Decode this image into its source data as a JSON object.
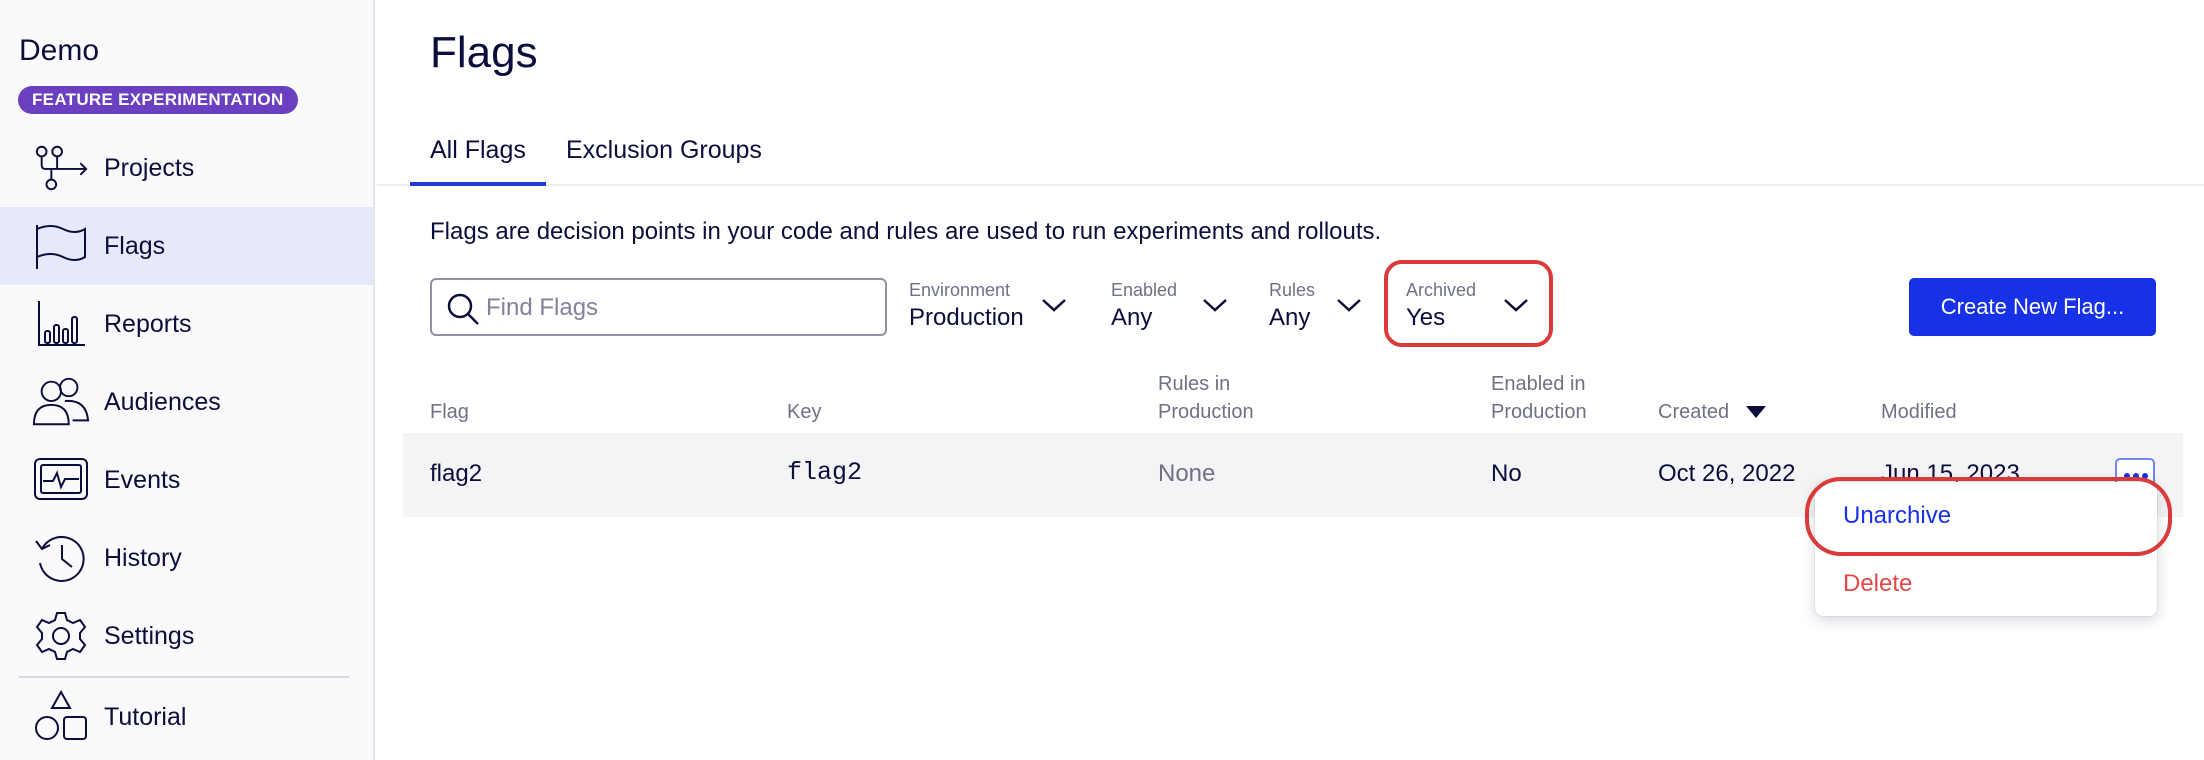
{
  "app": {
    "title": "Demo",
    "badge": "FEATURE EXPERIMENTATION"
  },
  "sidebar": {
    "items": [
      {
        "label": "Projects",
        "icon": "projects-icon"
      },
      {
        "label": "Flags",
        "icon": "flag-icon",
        "active": true
      },
      {
        "label": "Reports",
        "icon": "reports-icon"
      },
      {
        "label": "Audiences",
        "icon": "audiences-icon"
      },
      {
        "label": "Events",
        "icon": "events-icon"
      },
      {
        "label": "History",
        "icon": "history-icon"
      },
      {
        "label": "Settings",
        "icon": "gear-icon"
      },
      {
        "label": "Tutorial",
        "icon": "shapes-icon"
      }
    ]
  },
  "page": {
    "title": "Flags",
    "tabs": [
      {
        "label": "All Flags",
        "active": true
      },
      {
        "label": "Exclusion Groups"
      }
    ],
    "description": "Flags are decision points in your code and rules are used to run experiments and rollouts."
  },
  "search": {
    "placeholder": "Find Flags",
    "value": ""
  },
  "filters": [
    {
      "label": "Environment",
      "value": "Production"
    },
    {
      "label": "Enabled",
      "value": "Any"
    },
    {
      "label": "Rules",
      "value": "Any"
    },
    {
      "label": "Archived",
      "value": "Yes"
    }
  ],
  "create_button": "Create New Flag...",
  "table": {
    "columns": [
      {
        "line1": "",
        "line2": "Flag"
      },
      {
        "line1": "",
        "line2": "Key"
      },
      {
        "line1": "Rules in",
        "line2": "Production"
      },
      {
        "line1": "Enabled in",
        "line2": "Production"
      },
      {
        "line1": "",
        "line2": "Created",
        "sort": "descending"
      },
      {
        "line1": "",
        "line2": "Modified"
      }
    ],
    "rows": [
      {
        "flag": "flag2",
        "key": "flag2",
        "rules": "None",
        "enabled": "No",
        "created": "Oct 26, 2022",
        "modified": "Jun 15, 2023"
      }
    ]
  },
  "row_menu": {
    "items": [
      {
        "label": "Unarchive"
      },
      {
        "label": "Delete"
      }
    ]
  },
  "colors": {
    "accent": "#1731e6",
    "badge": "#6a3fc0",
    "highlight": "#d93a3a",
    "danger": "#e04848",
    "active_nav": "#e6e8fb"
  }
}
